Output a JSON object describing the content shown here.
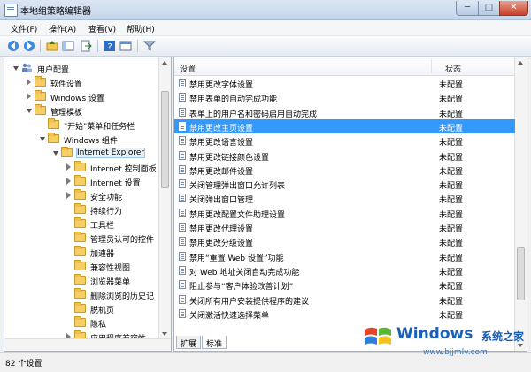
{
  "window": {
    "title": "本地组策略编辑器"
  },
  "menu": [
    "文件(F)",
    "操作(A)",
    "查看(V)",
    "帮助(H)"
  ],
  "tree": [
    {
      "label": "用户配置",
      "depth": 0,
      "expander": "open",
      "icon": "user-icon"
    },
    {
      "label": "软件设置",
      "depth": 1,
      "expander": "closed",
      "icon": "folder-icon"
    },
    {
      "label": "Windows 设置",
      "depth": 1,
      "expander": "closed",
      "icon": "folder-icon"
    },
    {
      "label": "管理模板",
      "depth": 1,
      "expander": "open",
      "icon": "folder-icon"
    },
    {
      "label": "\"开始\"菜单和任务栏",
      "depth": 2,
      "expander": "none",
      "icon": "folder-icon"
    },
    {
      "label": "Windows 组件",
      "depth": 2,
      "expander": "open",
      "icon": "folder-icon"
    },
    {
      "label": "Internet Explorer",
      "depth": 3,
      "expander": "open",
      "icon": "folder-icon",
      "selected": true
    },
    {
      "label": "Internet 控制面板",
      "depth": 4,
      "expander": "closed",
      "icon": "folder-icon"
    },
    {
      "label": "Internet 设置",
      "depth": 4,
      "expander": "closed",
      "icon": "folder-icon"
    },
    {
      "label": "安全功能",
      "depth": 4,
      "expander": "closed",
      "icon": "folder-icon"
    },
    {
      "label": "持续行为",
      "depth": 4,
      "expander": "none",
      "icon": "folder-icon"
    },
    {
      "label": "工具栏",
      "depth": 4,
      "expander": "none",
      "icon": "folder-icon"
    },
    {
      "label": "管理员认可的控件",
      "depth": 4,
      "expander": "none",
      "icon": "folder-icon"
    },
    {
      "label": "加速器",
      "depth": 4,
      "expander": "none",
      "icon": "folder-icon"
    },
    {
      "label": "兼容性视图",
      "depth": 4,
      "expander": "none",
      "icon": "folder-icon"
    },
    {
      "label": "浏览器菜单",
      "depth": 4,
      "expander": "none",
      "icon": "folder-icon"
    },
    {
      "label": "删除浏览的历史记",
      "depth": 4,
      "expander": "none",
      "icon": "folder-icon"
    },
    {
      "label": "脱机页",
      "depth": 4,
      "expander": "none",
      "icon": "folder-icon"
    },
    {
      "label": "隐私",
      "depth": 4,
      "expander": "none",
      "icon": "folder-icon"
    },
    {
      "label": "应用程序兼容性",
      "depth": 4,
      "expander": "closed",
      "icon": "folder-icon"
    }
  ],
  "list": {
    "col_setting": "设置",
    "col_state": "状态",
    "rows": [
      {
        "name": "禁用更改字体设置",
        "state": "未配置"
      },
      {
        "name": "禁用表单的自动完成功能",
        "state": "未配置"
      },
      {
        "name": "表单上的用户名和密码启用自动完成",
        "state": "未配置"
      },
      {
        "name": "禁用更改主页设置",
        "state": "未配置",
        "selected": true
      },
      {
        "name": "禁用更改语言设置",
        "state": "未配置"
      },
      {
        "name": "禁用更改链接颜色设置",
        "state": "未配置"
      },
      {
        "name": "禁用更改邮件设置",
        "state": "未配置"
      },
      {
        "name": "关闭管理弹出窗口允许列表",
        "state": "未配置"
      },
      {
        "name": "关闭弹出窗口管理",
        "state": "未配置"
      },
      {
        "name": "禁用更改配置文件助理设置",
        "state": "未配置"
      },
      {
        "name": "禁用更改代理设置",
        "state": "未配置"
      },
      {
        "name": "禁用更改分级设置",
        "state": "未配置"
      },
      {
        "name": "禁用“重置 Web 设置”功能",
        "state": "未配置"
      },
      {
        "name": "对 Web 地址关闭自动完成功能",
        "state": "未配置"
      },
      {
        "name": "阻止参与“客户体验改善计划”",
        "state": "未配置"
      },
      {
        "name": "关闭所有用户安装提供程序的建议",
        "state": "未配置"
      },
      {
        "name": "关闭激活快速选择菜单",
        "state": "未配置"
      }
    ]
  },
  "tabs": [
    "扩展",
    "标准"
  ],
  "status": "82 个设置",
  "watermark": {
    "brand": "Windows",
    "cn": "系统之家",
    "url": "www.bjjmlv.com"
  }
}
